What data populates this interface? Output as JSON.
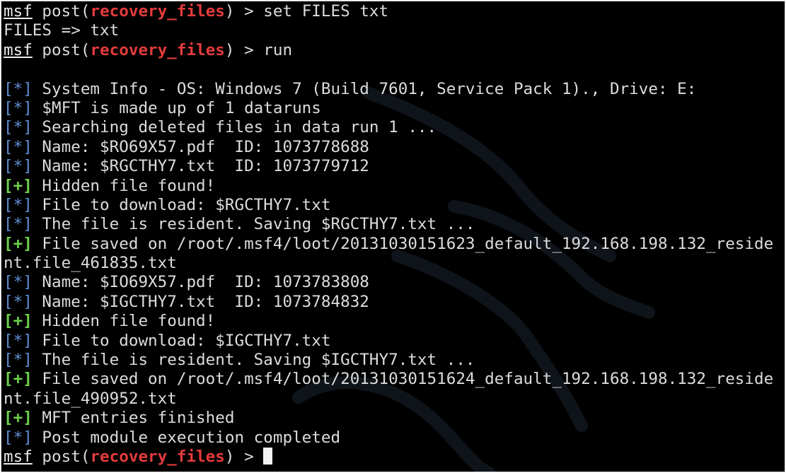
{
  "terminal": {
    "prompt": {
      "msf": "msf",
      "open": " post(",
      "module": "recovery_files",
      "close": ") > "
    },
    "prefixes": {
      "info": "[*]",
      "good": "[+]"
    },
    "lines": [
      {
        "type": "prompt",
        "command": "set FILES txt"
      },
      {
        "type": "plain",
        "text": "FILES => txt"
      },
      {
        "type": "prompt",
        "command": "run"
      },
      {
        "type": "blank",
        "text": ""
      },
      {
        "type": "info",
        "text": " System Info - OS: Windows 7 (Build 7601, Service Pack 1)., Drive: E:"
      },
      {
        "type": "info",
        "text": " $MFT is made up of 1 dataruns"
      },
      {
        "type": "info",
        "text": " Searching deleted files in data run 1 ..."
      },
      {
        "type": "info",
        "text": " Name: $RO69X57.pdf  ID: 1073778688"
      },
      {
        "type": "info",
        "text": " Name: $RGCTHY7.txt  ID: 1073779712"
      },
      {
        "type": "good",
        "text": " Hidden file found!"
      },
      {
        "type": "info",
        "text": " File to download: $RGCTHY7.txt"
      },
      {
        "type": "info",
        "text": " The file is resident. Saving $RGCTHY7.txt ..."
      },
      {
        "type": "good",
        "text": " File saved on /root/.msf4/loot/20131030151623_default_192.168.198.132_reside"
      },
      {
        "type": "plain",
        "text": "nt.file_461835.txt"
      },
      {
        "type": "info",
        "text": " Name: $IO69X57.pdf  ID: 1073783808"
      },
      {
        "type": "info",
        "text": " Name: $IGCTHY7.txt  ID: 1073784832"
      },
      {
        "type": "good",
        "text": " Hidden file found!"
      },
      {
        "type": "info",
        "text": " File to download: $IGCTHY7.txt"
      },
      {
        "type": "info",
        "text": " The file is resident. Saving $IGCTHY7.txt ..."
      },
      {
        "type": "good",
        "text": " File saved on /root/.msf4/loot/20131030151624_default_192.168.198.132_reside"
      },
      {
        "type": "plain",
        "text": "nt.file_490952.txt"
      },
      {
        "type": "good",
        "text": " MFT entries finished"
      },
      {
        "type": "info",
        "text": " Post module execution completed"
      },
      {
        "type": "prompt-cursor",
        "command": ""
      }
    ]
  },
  "colors": {
    "background": "#000000",
    "text": "#d8d8d8",
    "info_prefix": "#5f8fd6",
    "good_prefix": "#6ed14a",
    "module": "#e33b3b"
  },
  "icons": {
    "watermark": "kali-dragon-icon"
  }
}
